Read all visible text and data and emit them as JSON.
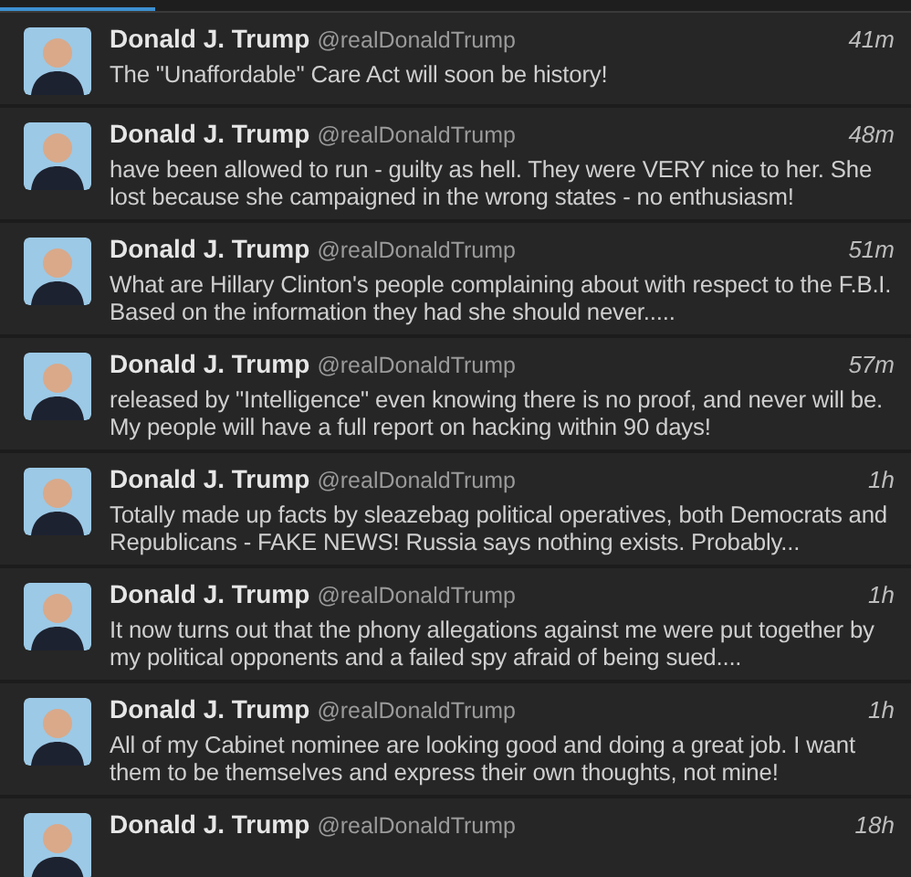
{
  "progress": {
    "level": 0.17
  },
  "tweets": [
    {
      "name": "Donald J. Trump",
      "handle": "@realDonaldTrump",
      "time": "41m",
      "text": "The \"Unaffordable\" Care Act will soon be history!"
    },
    {
      "name": "Donald J. Trump",
      "handle": "@realDonaldTrump",
      "time": "48m",
      "text": "have been allowed to run - guilty as hell. They were VERY nice to her. She lost because she campaigned in the wrong states - no enthusiasm!"
    },
    {
      "name": "Donald J. Trump",
      "handle": "@realDonaldTrump",
      "time": "51m",
      "text": "What are Hillary Clinton's people complaining about with respect to the F.B.I. Based on the information they had she should never....."
    },
    {
      "name": "Donald J. Trump",
      "handle": "@realDonaldTrump",
      "time": "57m",
      "text": "released by \"Intelligence\" even knowing there is no proof, and never will be. My people will have a full report on hacking within 90 days!"
    },
    {
      "name": "Donald J. Trump",
      "handle": "@realDonaldTrump",
      "time": "1h",
      "text": "Totally made up facts by sleazebag political operatives, both Democrats and Republicans - FAKE NEWS! Russia says nothing exists. Probably..."
    },
    {
      "name": "Donald J. Trump",
      "handle": "@realDonaldTrump",
      "time": "1h",
      "text": "It now turns out that the phony allegations against me were put together by my political opponents and a failed spy afraid of being sued...."
    },
    {
      "name": "Donald J. Trump",
      "handle": "@realDonaldTrump",
      "time": "1h",
      "text": "All of my Cabinet nominee are looking good and doing a great job. I want them to be themselves and express their own thoughts, not mine!"
    },
    {
      "name": "Donald J. Trump",
      "handle": "@realDonaldTrump",
      "time": "18h"
    }
  ]
}
